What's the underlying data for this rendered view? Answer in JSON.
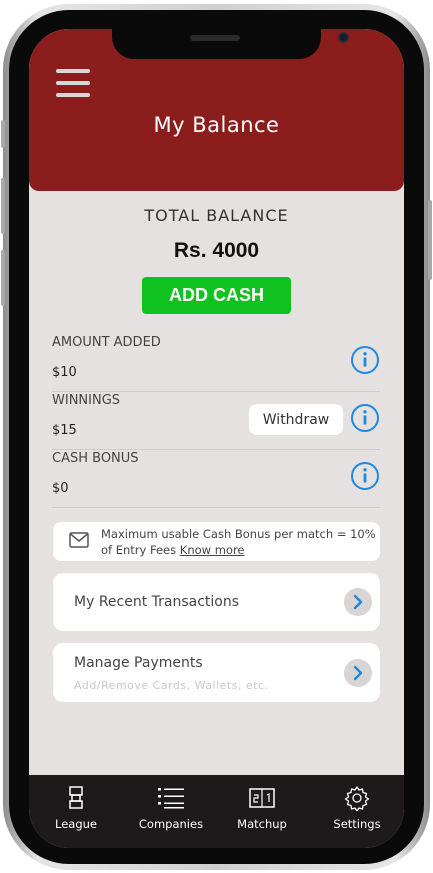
{
  "header": {
    "title": "My Balance"
  },
  "balance": {
    "label": "TOTAL BALANCE",
    "value": "Rs. 4000",
    "add_cash_label": "ADD CASH"
  },
  "rows": [
    {
      "label": "AMOUNT ADDED",
      "value": "$10"
    },
    {
      "label": "WINNINGS",
      "value": "$15",
      "action": "Withdraw"
    },
    {
      "label": "CASH BONUS",
      "value": "$0"
    }
  ],
  "notice": {
    "text": "Maximum usable Cash Bonus per match = 10% of Entry Fees ",
    "link": "Know more"
  },
  "cards": [
    {
      "title": "My Recent Transactions"
    },
    {
      "title": "Manage Payments",
      "subtitle": "Add/Remove Cards, Wallets, etc."
    }
  ],
  "nav": [
    {
      "label": "League",
      "icon": "trophy-icon"
    },
    {
      "label": "Companies",
      "icon": "list-icon"
    },
    {
      "label": "Matchup",
      "icon": "scoreboard-icon"
    },
    {
      "label": "Settings",
      "icon": "gear-icon"
    }
  ],
  "colors": {
    "header": "#8b1e1c",
    "add_cash": "#10c21f",
    "info": "#1e88e5",
    "background": "#e5e1e1"
  }
}
